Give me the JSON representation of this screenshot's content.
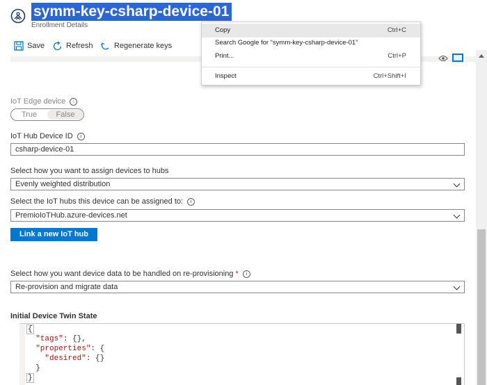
{
  "header": {
    "title": "symm-key-csharp-device-01",
    "subtitle": "Enrollment Details"
  },
  "toolbar": {
    "save_label": "Save",
    "refresh_label": "Refresh",
    "regenerate_label": "Regenerate keys"
  },
  "form": {
    "iot_edge_label": "IoT Edge device",
    "toggle_true": "True",
    "toggle_false": "False",
    "device_id_label": "IoT Hub Device ID",
    "device_id_value": "csharp-device-01",
    "assign_label": "Select how you want to assign devices to hubs",
    "assign_value": "Evenly weighted distribution",
    "hubs_label": "Select the IoT hubs this device can be assigned to:",
    "hubs_value": "PremioIoTHub.azure-devices.net",
    "link_button": "Link a new IoT hub",
    "reprov_label": "Select how you want device data to be handled on re-provisioning",
    "required_mark": "*",
    "reprov_value": "Re-provision and migrate data",
    "twin_title": "Initial Device Twin State"
  },
  "twin_code": {
    "line1": "{",
    "tags_key": "\"tags\"",
    "tags_rest": ": {},",
    "props_key": "\"properties\"",
    "props_rest": ": {",
    "desired_key": "\"desired\"",
    "desired_rest": ": {}",
    "line5": "}",
    "line6": "}"
  },
  "context_menu": {
    "items": [
      {
        "label": "Copy",
        "shortcut": "Ctrl+C"
      },
      {
        "label": "Search Google for “symm-key-csharp-device-01”",
        "shortcut": ""
      },
      {
        "label": "Print...",
        "shortcut": "Ctrl+P"
      },
      {
        "label": "Inspect",
        "shortcut": "Ctrl+Shift+I"
      }
    ]
  },
  "colors": {
    "accent": "#0078d4",
    "selection": "#2b66d6"
  }
}
